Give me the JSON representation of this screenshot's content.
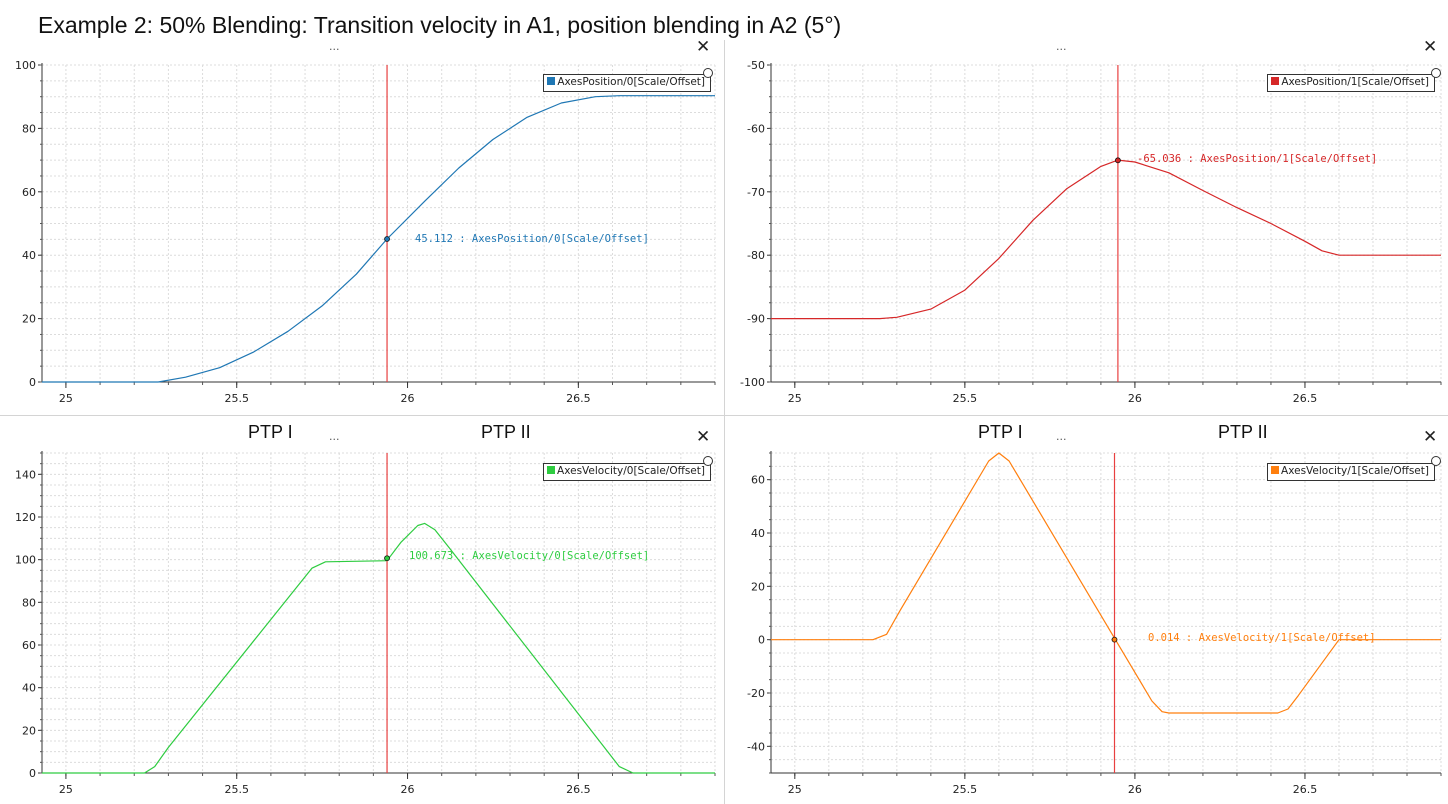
{
  "title": "Example 2: 50% Blending: Transition velocity in A1, position blending in A2 (5°)",
  "menu_label": "...",
  "close_label": "✕",
  "chart_data": [
    {
      "id": "a1-position",
      "type": "line",
      "legend": "AxesPosition/0[Scale/Offset]",
      "color": "#1f77b4",
      "xlim": [
        24.93,
        26.9
      ],
      "ylim": [
        0,
        100
      ],
      "xticks": [
        25,
        25.5,
        26,
        26.5
      ],
      "xtick_labels": [
        "25",
        "25.5",
        "26",
        "26.5"
      ],
      "yticks": [
        0,
        20,
        40,
        60,
        80,
        100
      ],
      "ytick_labels": [
        "0",
        "20",
        "40",
        "60",
        "80",
        "100"
      ],
      "grid": true,
      "legend_position": "top-right",
      "cursor": {
        "x": 25.94,
        "y": 45.112,
        "label": "45.112 : AxesPosition/0[Scale/Offset]"
      },
      "annotations": [],
      "series": [
        {
          "name": "AxesPosition/0[Scale/Offset]",
          "x": [
            24.93,
            25.27,
            25.35,
            25.45,
            25.55,
            25.65,
            25.75,
            25.85,
            25.94,
            26.05,
            26.15,
            26.25,
            26.35,
            26.45,
            26.55,
            26.62,
            26.9
          ],
          "y": [
            0,
            0,
            1.5,
            4.5,
            9.5,
            16,
            24,
            34,
            45.112,
            57,
            67.5,
            76.5,
            83.5,
            88,
            90,
            90.3,
            90.3
          ]
        }
      ]
    },
    {
      "id": "a2-position",
      "type": "line",
      "legend": "AxesPosition/1[Scale/Offset]",
      "color": "#d62728",
      "xlim": [
        24.93,
        26.9
      ],
      "ylim": [
        -100,
        -50
      ],
      "xticks": [
        25,
        25.5,
        26,
        26.5
      ],
      "xtick_labels": [
        "25",
        "25.5",
        "26",
        "26.5"
      ],
      "yticks": [
        -100,
        -90,
        -80,
        -70,
        -60,
        -50
      ],
      "ytick_labels": [
        "-100",
        "-90",
        "-80",
        "-70",
        "-60",
        "-50"
      ],
      "grid": true,
      "legend_position": "top-right",
      "cursor": {
        "x": 25.95,
        "y": -65.036,
        "label": "-65.036 : AxesPosition/1[Scale/Offset]"
      },
      "annotations": [],
      "series": [
        {
          "name": "AxesPosition/1[Scale/Offset]",
          "x": [
            24.93,
            25.25,
            25.3,
            25.4,
            25.5,
            25.6,
            25.7,
            25.8,
            25.9,
            25.95,
            26.0,
            26.1,
            26.2,
            26.3,
            26.4,
            26.5,
            26.55,
            26.6,
            26.9
          ],
          "y": [
            -90,
            -90,
            -89.8,
            -88.5,
            -85.5,
            -80.5,
            -74.5,
            -69.5,
            -66,
            -65,
            -65.3,
            -67,
            -69.8,
            -72.5,
            -75,
            -77.8,
            -79.3,
            -80,
            -80
          ]
        }
      ]
    },
    {
      "id": "a1-velocity",
      "type": "line",
      "legend": "AxesVelocity/0[Scale/Offset]",
      "color": "#2ecc40",
      "xlim": [
        24.93,
        26.9
      ],
      "ylim": [
        0,
        150
      ],
      "xticks": [
        25,
        25.5,
        26,
        26.5
      ],
      "xtick_labels": [
        "25",
        "25.5",
        "26",
        "26.5"
      ],
      "yticks": [
        0,
        20,
        40,
        60,
        80,
        100,
        120,
        140
      ],
      "ytick_labels": [
        "0",
        "20",
        "40",
        "60",
        "80",
        "100",
        "120",
        "140"
      ],
      "grid": true,
      "legend_position": "top-right",
      "cursor": {
        "x": 25.94,
        "y": 100.673,
        "label": "100.673 : AxesVelocity/0[Scale/Offset]"
      },
      "annotations": [
        {
          "text": "PTP I",
          "x": 25.53
        },
        {
          "text": "PTP II",
          "x": 26.28
        }
      ],
      "series": [
        {
          "name": "AxesVelocity/0[Scale/Offset]",
          "x": [
            24.93,
            25.23,
            25.26,
            25.3,
            25.72,
            25.76,
            25.94,
            25.98,
            26.03,
            26.05,
            26.08,
            26.12,
            26.62,
            26.66,
            26.9
          ],
          "y": [
            0,
            0,
            3,
            12,
            96,
            99,
            99.5,
            108,
            116,
            117,
            114,
            106,
            3,
            0,
            0
          ]
        }
      ]
    },
    {
      "id": "a2-velocity",
      "type": "line",
      "legend": "AxesVelocity/1[Scale/Offset]",
      "color": "#ff7f0e",
      "xlim": [
        24.93,
        26.9
      ],
      "ylim": [
        -50,
        70
      ],
      "xticks": [
        25,
        25.5,
        26,
        26.5
      ],
      "xtick_labels": [
        "25",
        "25.5",
        "26",
        "26.5"
      ],
      "yticks": [
        -40,
        -20,
        0,
        20,
        40,
        60
      ],
      "ytick_labels": [
        "-40",
        "-20",
        "0",
        "20",
        "40",
        "60"
      ],
      "grid": true,
      "legend_position": "top-right",
      "cursor": {
        "x": 25.94,
        "y": 0.014,
        "label": "0.014 : AxesVelocity/1[Scale/Offset]"
      },
      "annotations": [
        {
          "text": "PTP I",
          "x": 25.55
        },
        {
          "text": "PTP II",
          "x": 26.28
        }
      ],
      "series": [
        {
          "name": "AxesVelocity/1[Scale/Offset]",
          "x": [
            24.93,
            25.23,
            25.27,
            25.31,
            25.57,
            25.6,
            25.63,
            26.05,
            26.08,
            26.1,
            26.42,
            26.45,
            26.48,
            26.6,
            26.9
          ],
          "y": [
            0,
            0,
            2,
            11,
            67,
            70,
            67,
            -23,
            -27,
            -27.5,
            -27.5,
            -26,
            -21,
            0,
            0
          ]
        }
      ]
    }
  ]
}
